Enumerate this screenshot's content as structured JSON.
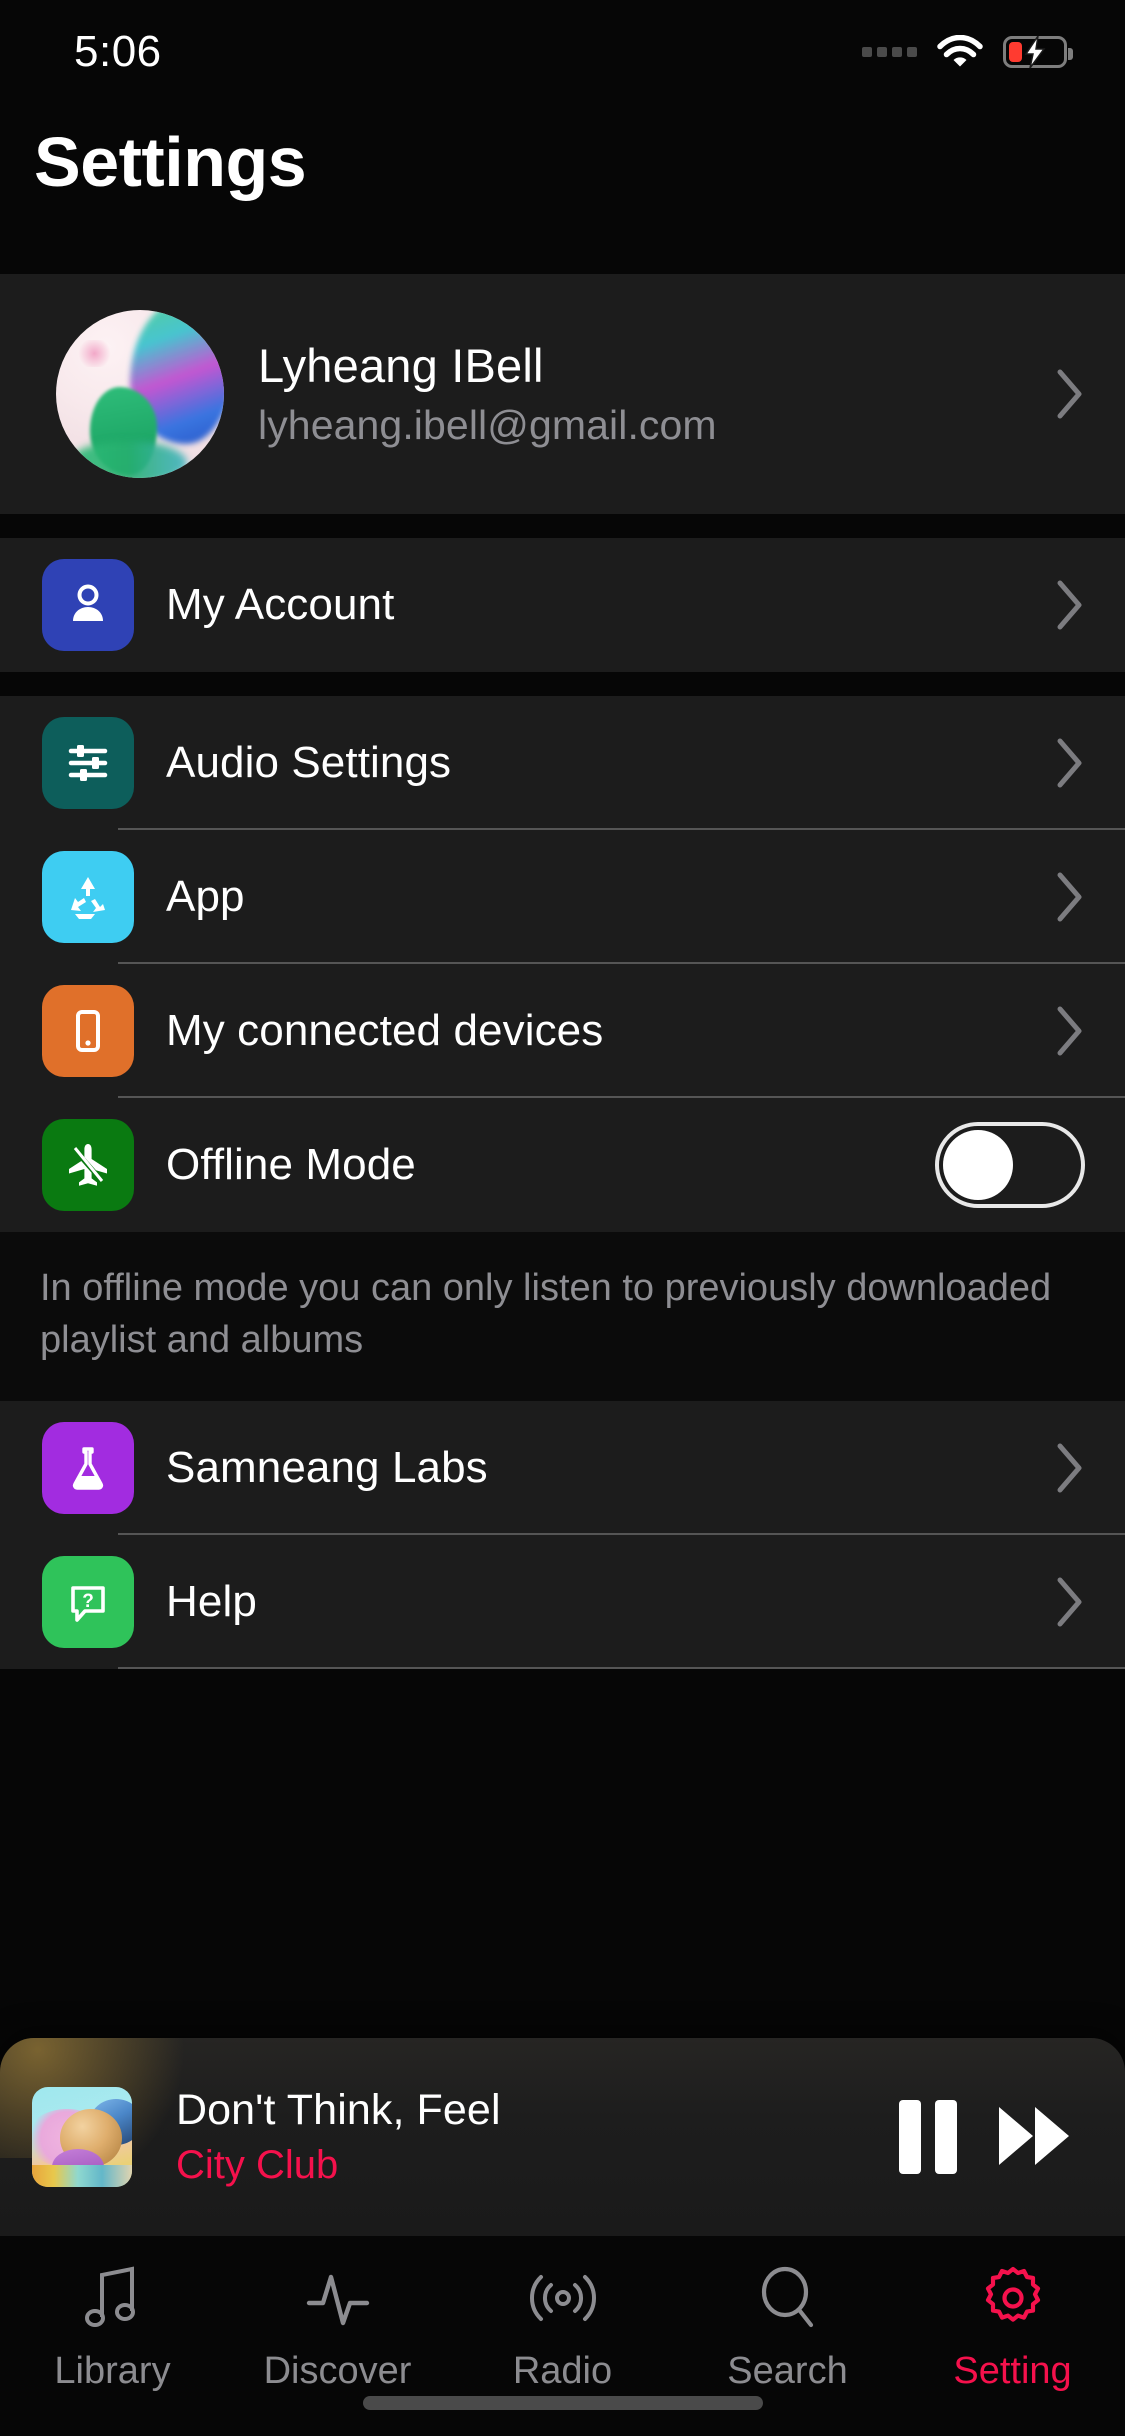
{
  "status_bar": {
    "time": "5:06",
    "signal_icon": "signal-dots-icon",
    "wifi_icon": "wifi-icon",
    "battery_icon": "battery-charging-icon",
    "battery_color": "#ff3b30"
  },
  "header": {
    "title": "Settings"
  },
  "profile": {
    "name": "Lyheang IBell",
    "email": "lyheang.ibell@gmail.com",
    "avatar_icon": "avatar",
    "chevron_icon": "chevron-right-icon"
  },
  "sections": [
    {
      "rows": [
        {
          "label": "My Account",
          "icon": "person-icon",
          "icon_bg": "#2f42b5",
          "accessory": "chevron",
          "divider": false
        }
      ]
    },
    {
      "rows": [
        {
          "label": "Audio Settings",
          "icon": "sliders-icon",
          "icon_bg": "#0d5e5b",
          "accessory": "chevron",
          "divider": true
        },
        {
          "label": "App",
          "icon": "recycle-icon",
          "icon_bg": "#3ecdf2",
          "accessory": "chevron",
          "divider": true
        },
        {
          "label": "My connected devices",
          "icon": "phone-icon",
          "icon_bg": "#e0702a",
          "accessory": "chevron",
          "divider": true
        },
        {
          "label": "Offline Mode",
          "icon": "airplane-icon",
          "icon_bg": "#0a7a11",
          "accessory": "toggle",
          "toggle_on": false,
          "divider": false
        }
      ]
    }
  ],
  "offline_note": "In offline mode you can only listen to previously downloaded playlist and albums",
  "sections2": [
    {
      "rows": [
        {
          "label": "Samneang Labs",
          "icon": "flask-icon",
          "icon_bg": "#a22ce0",
          "accessory": "chevron",
          "divider": true
        },
        {
          "label": "Help",
          "icon": "help-bubble-icon",
          "icon_bg": "#2fc35a",
          "accessory": "chevron",
          "divider": true
        }
      ]
    }
  ],
  "player": {
    "title": "Don't Think, Feel",
    "artist": "City Club",
    "artist_color": "#f5114c",
    "album_art_icon": "album-art",
    "pause_icon": "pause-icon",
    "next_icon": "fast-forward-icon"
  },
  "tabbar": {
    "active_color": "#f5114c",
    "inactive_color": "#8c8c90",
    "items": [
      {
        "label": "Library",
        "icon": "music-note-icon",
        "active": false
      },
      {
        "label": "Discover",
        "icon": "pulse-icon",
        "active": false
      },
      {
        "label": "Radio",
        "icon": "broadcast-icon",
        "active": false
      },
      {
        "label": "Search",
        "icon": "search-icon",
        "active": false
      },
      {
        "label": "Setting",
        "icon": "gear-icon",
        "active": true
      }
    ]
  }
}
